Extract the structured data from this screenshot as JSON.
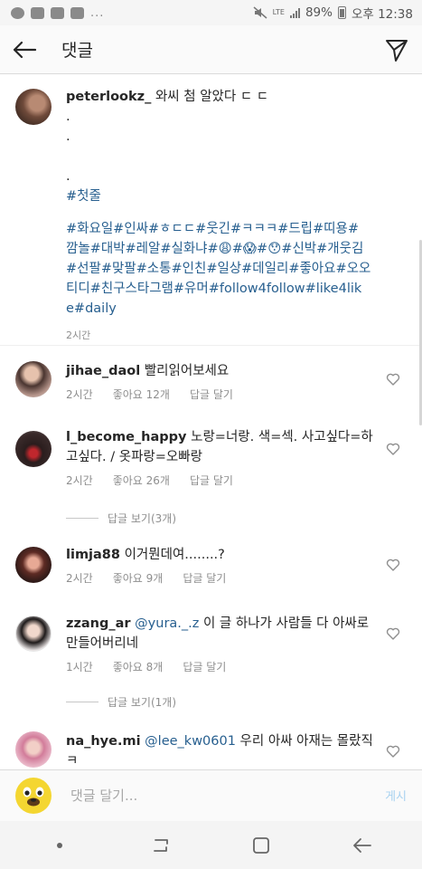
{
  "status_bar": {
    "signal_label": "LTE",
    "battery": "89%",
    "clock": "오후 12:38",
    "more": "..."
  },
  "header": {
    "title": "댓글",
    "icons": [
      "back-arrow-icon",
      "send-icon"
    ]
  },
  "caption": {
    "username": "peterlookz_",
    "lines": [
      "와씨 첨 알았다 ㄷ ㄷ",
      ".",
      ".",
      "",
      ".",
      "#첫줄",
      "",
      "#화요일#인싸#ㅎㄷㄷ#웃긴#ㅋㅋㅋ#드립#띠용#",
      "깜놀#대박#레알#실화냐#😩#😱#😯#신박#개웃김",
      "#선팔#맞팔#소통#인친#일상#데일리#좋아요#오오",
      "티디#친구스타그램#유머#follow4follow#like4lik",
      "e#daily"
    ],
    "time": "2시간"
  },
  "comments": [
    {
      "username": "jihae_daol",
      "text": "빨리읽어보세요",
      "mention": "",
      "time": "2시간",
      "likes": "",
      "reply": "답글 달기"
    },
    {
      "username": "l_become_happy",
      "text": "노랑=너랑. 색=섹. 사고싶다=하고싶다. / 옷파랑=오빠랑",
      "mention": "",
      "time": "2시간",
      "likes": "좋아요 26개",
      "reply": "답글 달기",
      "view_replies": "답글 보기(3개)"
    },
    {
      "username": "limja88",
      "text": "이거뭔데여........?",
      "mention": "",
      "time": "2시간",
      "likes": "좋아요 9개",
      "reply": "답글 달기"
    },
    {
      "username": "zzang_ar",
      "text": " 이 글 하나가 사람들 다 아싸로 만들어버리네",
      "mention": "@yura._.z",
      "time": "1시간",
      "likes": "좋아요 8개",
      "reply": "답글 달기",
      "view_replies": "답글 보기(1개)"
    },
    {
      "username": "na_hye.mi",
      "text": " 우리 아싸 아재는 몰랐직 ㅋ",
      "mention": "@lee_kw0601",
      "time": "",
      "likes": "",
      "reply": ""
    }
  ],
  "jihae_likes": "좋아요 12개",
  "composer": {
    "placeholder": "댓글 달기...",
    "post": "게시"
  }
}
